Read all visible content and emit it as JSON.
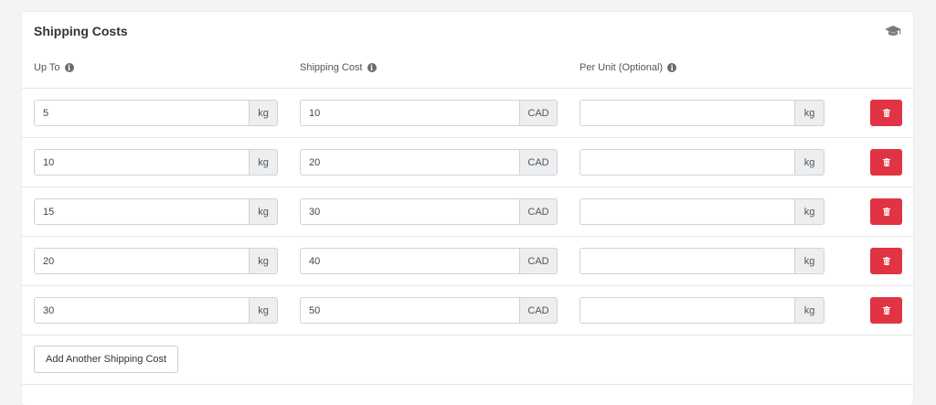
{
  "card": {
    "title": "Shipping Costs",
    "header_icon": "graduation-cap-icon"
  },
  "columns": {
    "up_to": "Up To",
    "shipping_cost": "Shipping Cost",
    "per_unit": "Per Unit (Optional)",
    "info_icon": "info-circle-icon"
  },
  "rows": [
    {
      "up_to": "5",
      "up_to_unit": "kg",
      "cost": "10",
      "currency": "CAD",
      "per_unit": "",
      "per_unit_unit": "kg"
    },
    {
      "up_to": "10",
      "up_to_unit": "kg",
      "cost": "20",
      "currency": "CAD",
      "per_unit": "",
      "per_unit_unit": "kg"
    },
    {
      "up_to": "15",
      "up_to_unit": "kg",
      "cost": "30",
      "currency": "CAD",
      "per_unit": "",
      "per_unit_unit": "kg"
    },
    {
      "up_to": "20",
      "up_to_unit": "kg",
      "cost": "40",
      "currency": "CAD",
      "per_unit": "",
      "per_unit_unit": "kg"
    },
    {
      "up_to": "30",
      "up_to_unit": "kg",
      "cost": "50",
      "currency": "CAD",
      "per_unit": "",
      "per_unit_unit": "kg"
    }
  ],
  "delete_icon": "trash-icon",
  "add_button_label": "Add Another Shipping Cost",
  "colors": {
    "delete": "#e03445",
    "addon_bg": "#eceef0",
    "page_bg": "#f3f4f6"
  }
}
